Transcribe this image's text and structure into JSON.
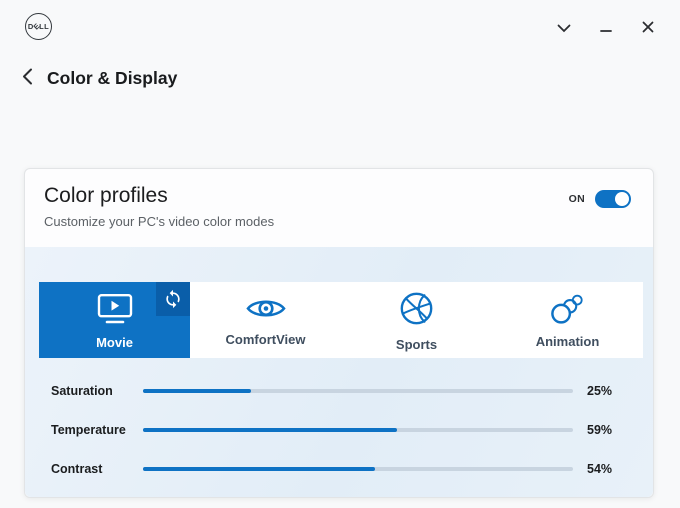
{
  "window": {
    "brand": "DELL",
    "icons": {
      "menu": "chevron-down-icon",
      "minimize": "minimize-icon",
      "close": "close-icon"
    }
  },
  "header": {
    "title": "Color & Display",
    "back_icon": "chevron-left-icon"
  },
  "panel": {
    "title": "Color profiles",
    "subtitle": "Customize your PC's video color modes",
    "toggle_label": "ON",
    "toggle_state": "on"
  },
  "profiles": {
    "tabs": [
      {
        "label": "Movie",
        "icon": "monitor-play-icon",
        "selected": true,
        "badge_icon": "sync-refresh-icon"
      },
      {
        "label": "ComfortView",
        "icon": "eye-icon",
        "selected": false
      },
      {
        "label": "Sports",
        "icon": "basketball-icon",
        "selected": false
      },
      {
        "label": "Animation",
        "icon": "motion-circles-icon",
        "selected": false
      }
    ]
  },
  "sliders": [
    {
      "label": "Saturation",
      "value": 25,
      "display": "25%"
    },
    {
      "label": "Temperature",
      "value": 59,
      "display": "59%"
    },
    {
      "label": "Contrast",
      "value": 54,
      "display": "54%"
    }
  ],
  "colors": {
    "accent": "#0e72c4",
    "accent_dark": "#0a5ea9",
    "track": "#c8d4e0",
    "content_bg": "#e6eff8"
  }
}
